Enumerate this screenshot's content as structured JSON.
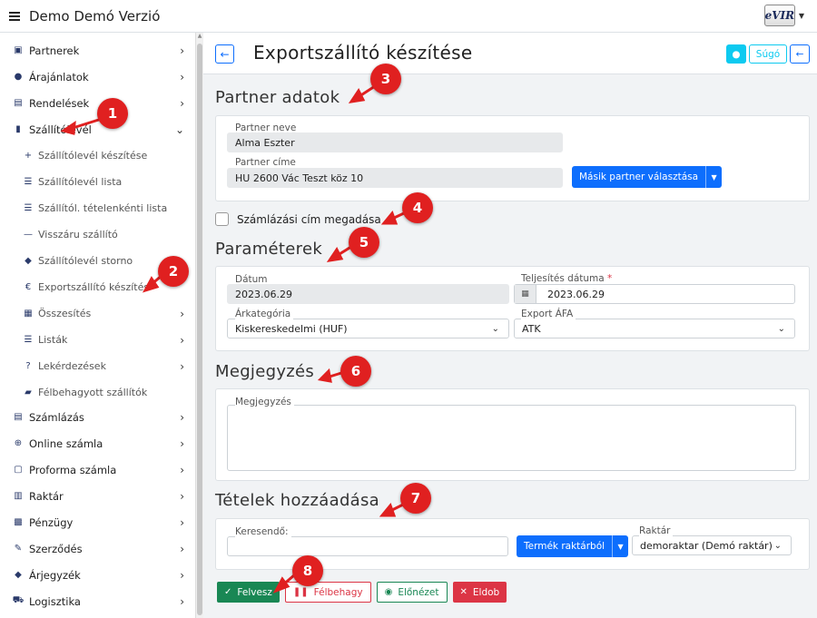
{
  "app": {
    "title": "Demo Demó Verzió",
    "logo_text": "eVIR"
  },
  "sidebar": {
    "items": [
      {
        "label": "Partnerek",
        "icon": "id-card-icon"
      },
      {
        "label": "Árajánlatok",
        "icon": "users-icon"
      },
      {
        "label": "Rendelések",
        "icon": "document-icon"
      },
      {
        "label": "Szállítólevél",
        "icon": "clipboard-icon"
      },
      {
        "label": "Összesítés",
        "icon": "calculator-icon"
      },
      {
        "label": "Listák",
        "icon": "list-icon"
      },
      {
        "label": "Lekérdezések",
        "icon": "question-circle-icon"
      },
      {
        "label": "Félbehagyott szállítók",
        "icon": "lock-open-icon"
      },
      {
        "label": "Számlázás",
        "icon": "invoice-icon"
      },
      {
        "label": "Online számla",
        "icon": "globe-icon"
      },
      {
        "label": "Proforma számla",
        "icon": "proforma-icon"
      },
      {
        "label": "Raktár",
        "icon": "warehouse-icon"
      },
      {
        "label": "Pénzügy",
        "icon": "money-icon"
      },
      {
        "label": "Szerződés",
        "icon": "contract-icon"
      },
      {
        "label": "Árjegyzék",
        "icon": "tag-icon"
      },
      {
        "label": "Logisztika",
        "icon": "truck-icon"
      }
    ],
    "subitems": [
      {
        "label": "Szállítólevél készítése",
        "icon": "plus-icon"
      },
      {
        "label": "Szállítólevél lista",
        "icon": "list-icon"
      },
      {
        "label": "Szállítól. tételenkénti lista",
        "icon": "numbered-list-icon"
      },
      {
        "label": "Visszáru szállító",
        "icon": "minus-icon"
      },
      {
        "label": "Szállítólevél storno",
        "icon": "eraser-icon"
      },
      {
        "label": "Exportszállító készítés",
        "icon": "euro-icon"
      }
    ]
  },
  "header": {
    "title": "Exportszállító készítése",
    "help_label": "Súgó"
  },
  "partner": {
    "section_title": "Partner adatok",
    "name_label": "Partner neve",
    "name_value": "Alma Eszter",
    "address_label": "Partner címe",
    "address_value": "HU 2600 Vác Teszt köz 10",
    "other_partner_button": "Másik partner választása"
  },
  "billing": {
    "checkbox_label": "Számlázási cím megadása"
  },
  "params": {
    "section_title": "Paraméterek",
    "date_label": "Dátum",
    "date_value": "2023.06.29",
    "fulfil_label": "Teljesítés dátuma",
    "fulfil_value": "2023.06.29",
    "price_cat_label": "Árkategória",
    "price_cat_value": "Kiskereskedelmi (HUF)",
    "vat_label": "Export ÁFA",
    "vat_value": "ATK"
  },
  "note": {
    "section_title": "Megjegyzés",
    "field_label": "Megjegyzés"
  },
  "items": {
    "section_title": "Tételek hozzáadása",
    "search_label": "Keresendő:",
    "search_value": "",
    "product_button": "Termék raktárból",
    "warehouse_label": "Raktár",
    "warehouse_value": "demoraktar (Demó raktár)"
  },
  "actions": {
    "save": "Felvesz",
    "pause": "Félbehagy",
    "preview": "Előnézet",
    "discard": "Eldob"
  },
  "markers": [
    "1",
    "2",
    "3",
    "4",
    "5",
    "6",
    "7",
    "8"
  ],
  "colors": {
    "primary": "#0d6efd",
    "success": "#198754",
    "danger": "#dc3545",
    "info": "#0dcaf0",
    "marker": "#e02020"
  }
}
